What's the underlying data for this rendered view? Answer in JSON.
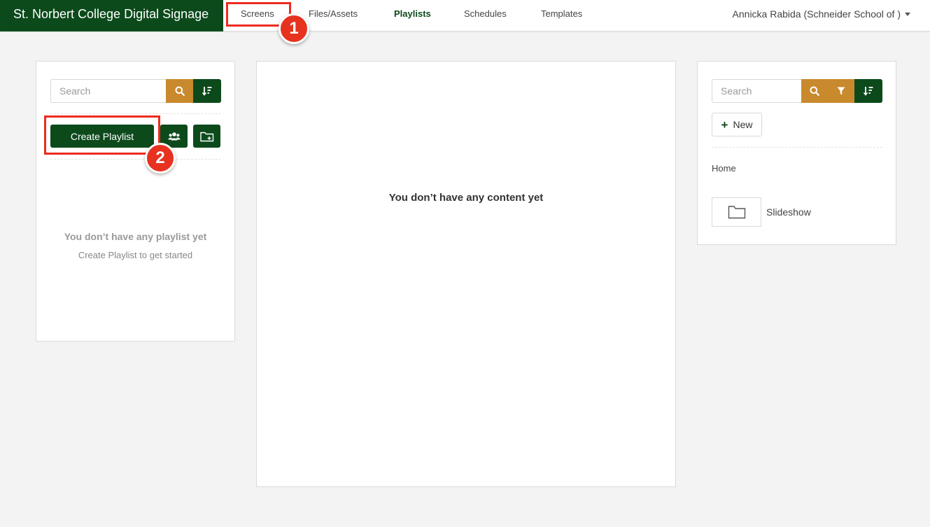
{
  "header": {
    "brand": "St. Norbert College Digital Signage",
    "nav": [
      {
        "label": "Screens"
      },
      {
        "label": "Files/Assets"
      },
      {
        "label": "Playlists",
        "active": true
      },
      {
        "label": "Schedules"
      },
      {
        "label": "Templates"
      }
    ],
    "user": "Annicka Rabida (Schneider School of )"
  },
  "left_panel": {
    "search_placeholder": "Search",
    "create_label": "Create Playlist",
    "empty_title": "You don’t have any playlist yet",
    "empty_sub": "Create Playlist to get started"
  },
  "center_panel": {
    "empty_text": "You don’t have any content yet"
  },
  "right_panel": {
    "search_placeholder": "Search",
    "new_label": "New",
    "breadcrumb": "Home",
    "folders": [
      {
        "label": "Slideshow"
      }
    ]
  },
  "annotations": {
    "badge1": "1",
    "badge2": "2"
  },
  "colors": {
    "brand_green": "#0c4a1c",
    "accent_gold": "#c9892d",
    "highlight_red": "#ee2a1f"
  },
  "icons": {
    "search": "search-icon",
    "sort": "sort-icon",
    "users": "users-icon",
    "new_folder": "folder-plus-icon",
    "filter": "filter-icon",
    "folder": "folder-icon",
    "plus": "plus-icon",
    "caret": "caret-down-icon"
  }
}
